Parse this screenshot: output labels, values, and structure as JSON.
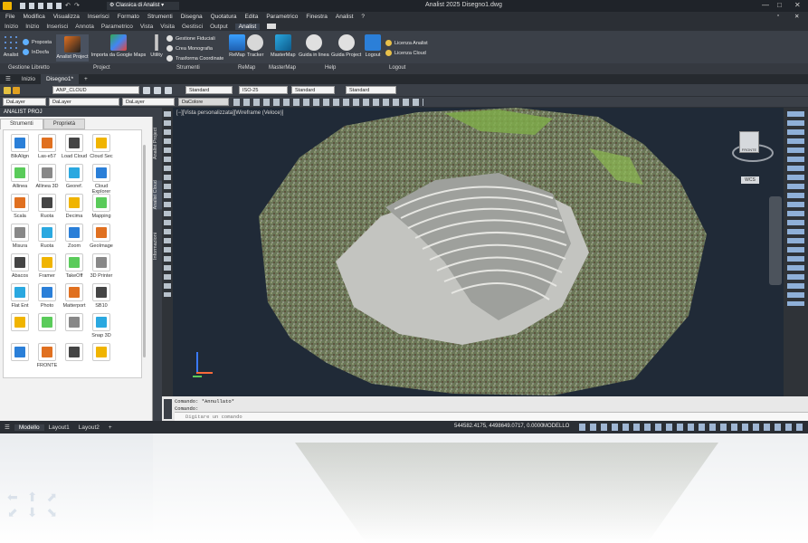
{
  "window": {
    "title": "Analist 2025   Disegno1.dwg",
    "workspace": "Classica di Analist"
  },
  "menubar": [
    "File",
    "Modifica",
    "Visualizza",
    "Inserisci",
    "Formato",
    "Strumenti",
    "Disegna",
    "Quotatura",
    "Edita",
    "Parametrico",
    "Finestra",
    "Analist",
    "?"
  ],
  "ribbon_tabs": [
    "Inizio",
    "Inizio",
    "Inserisci",
    "Annota",
    "Parametrico",
    "Vista",
    "Visita",
    "Gestisci",
    "Output",
    "Analist"
  ],
  "ribbon_active_tab": "Analist",
  "ribbon": {
    "gestione_libretto": {
      "analist": "Analist",
      "proposta": "Proposta",
      "indocfa": "InDocfa",
      "group": "Gestione Libretto"
    },
    "project": {
      "analist_project": "Analist Project",
      "importa": "Importa da Google Maps",
      "group": "Project"
    },
    "strumenti": {
      "utility": "Utility",
      "fiduciali": "Gestione Fiduciali",
      "monografia": "Crea Monografia",
      "trasforma": "Trasforma Coordinate",
      "group": "Strumenti"
    },
    "remap": {
      "remap": "ReMap",
      "tracker": "Tracker",
      "group": "ReMap"
    },
    "mastermap": {
      "mastermap": "MasterMap",
      "group": "MasterMap"
    },
    "help": {
      "guida": "Guida in linea",
      "guida_project": "Guida Project",
      "group": "Help"
    },
    "logout": {
      "logout": "Logout",
      "licenza_analist": "Licenza Analist",
      "licenza_cloud": "Licenza Cloud",
      "group": "Logout"
    }
  },
  "file_tabs": [
    "Inizio",
    "Disegno1*"
  ],
  "toolbar": {
    "layer": "ANP_CLOUD",
    "text_style": "Standard",
    "dim_style": "ISO-25",
    "table_style": "Standard",
    "mleader_style": "Standard",
    "color": "DaLayer",
    "linetype": "DaLayer",
    "lineweight": "DaLayer",
    "plotstyle": "DaColore"
  },
  "palette": {
    "title": "ANALIST PROJ",
    "tabs": [
      "Strumenti",
      "Proprietà"
    ],
    "tools": [
      [
        "BlkAlign",
        "Las-e57",
        "Load Cloud",
        "Cloud Sec"
      ],
      [
        "Allinea",
        "Allinea 3D",
        "Georef.",
        "Cloud Explorer"
      ],
      [
        "Scala",
        "Ruota",
        "Decima",
        "Mapping"
      ],
      [
        "Misura",
        "Ruota",
        "Zoom",
        "GeoImage"
      ],
      [
        "Abacos",
        "Framer",
        "TakeOff",
        "3D Printer"
      ],
      [
        "Flat Ent",
        "Photo",
        "Matterport",
        "SB10"
      ],
      [
        "",
        "",
        "",
        "Snap 3D"
      ],
      [
        "",
        "FRONTE",
        "",
        ""
      ]
    ]
  },
  "side_tabs": [
    "Analist Project",
    "Analist Cloud",
    "Informazioni"
  ],
  "viewport": {
    "label": "[−][Vista personalizzata][Wireframe (Veloce)]",
    "viewcube_face": "FRONTE",
    "wcs": "WCS"
  },
  "command": {
    "lines": [
      "Comando: *Annullato*",
      "Comando:"
    ],
    "placeholder": "Digitare un comando"
  },
  "statusbar": {
    "layouts": [
      "Modello",
      "Layout1",
      "Layout2"
    ],
    "coords": "544582.4175, 4498649.0717, 0.0000",
    "mode": "MODELLO"
  }
}
